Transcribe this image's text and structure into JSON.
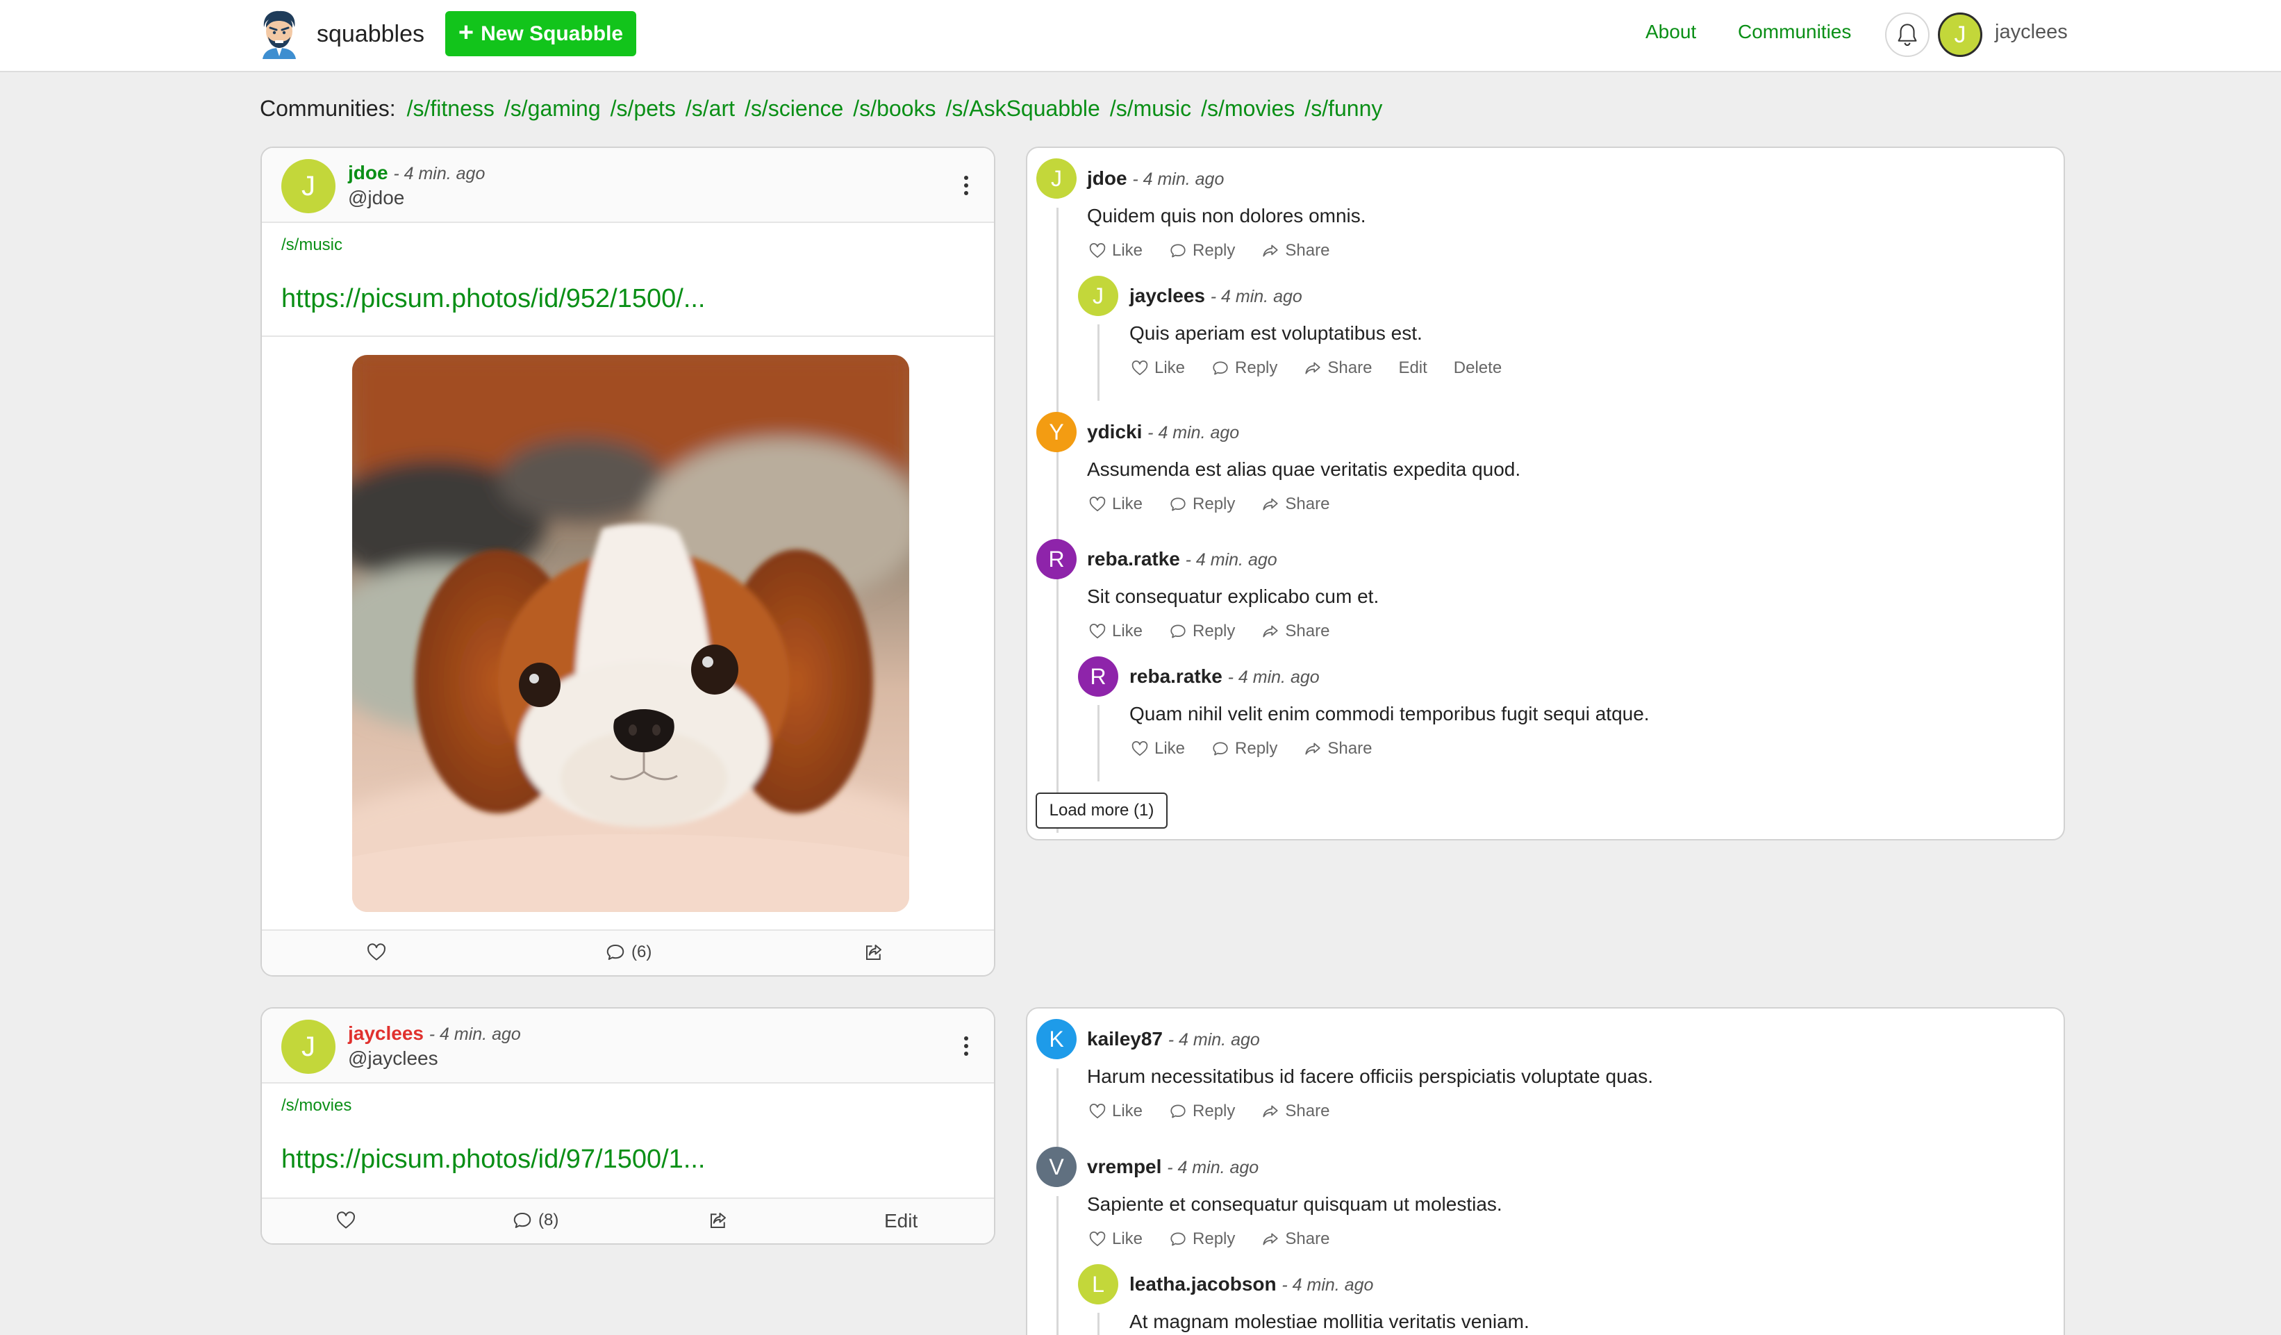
{
  "nav": {
    "brand": "squabbles",
    "new_button": "New Squabble",
    "about": "About",
    "communities": "Communities",
    "user_initial": "J",
    "username": "jayclees"
  },
  "communities_bar": {
    "label": "Communities:",
    "items": [
      "/s/fitness",
      "/s/gaming",
      "/s/pets",
      "/s/art",
      "/s/science",
      "/s/books",
      "/s/AskSquabble",
      "/s/music",
      "/s/movies",
      "/s/funny"
    ]
  },
  "posts": [
    {
      "initial": "J",
      "author": "jdoe",
      "time": "- 4 min. ago",
      "handle": "@jdoe",
      "community": "/s/music",
      "link": "https://picsum.photos/id/952/1500/...",
      "comment_count": "(6)"
    },
    {
      "initial": "J",
      "author": "jayclees",
      "time": "- 4 min. ago",
      "handle": "@jayclees",
      "community": "/s/movies",
      "link": "https://picsum.photos/id/97/1500/1...",
      "comment_count": "(8)",
      "edit": "Edit"
    }
  ],
  "actions": {
    "like": "Like",
    "reply": "Reply",
    "share": "Share",
    "edit": "Edit",
    "delete": "Delete"
  },
  "comments_1": [
    {
      "initial": "J",
      "author": "jdoe",
      "time": "- 4 min. ago",
      "text": "Quidem quis non dolores omnis.",
      "color": "#c3d73a"
    },
    {
      "initial": "J",
      "author": "jayclees",
      "time": "- 4 min. ago",
      "text": "Quis aperiam est voluptatibus est.",
      "color": "#c3d73a"
    },
    {
      "initial": "Y",
      "author": "ydicki",
      "time": "- 4 min. ago",
      "text": "Assumenda est alias quae veritatis expedita quod.",
      "color": "#f39c12"
    },
    {
      "initial": "R",
      "author": "reba.ratke",
      "time": "- 4 min. ago",
      "text": "Sit consequatur explicabo cum et.",
      "color": "#8e24aa"
    },
    {
      "initial": "R",
      "author": "reba.ratke",
      "time": "- 4 min. ago",
      "text": "Quam nihil velit enim commodi temporibus fugit sequi atque.",
      "color": "#8e24aa"
    }
  ],
  "load_more": "Load more (1)",
  "comments_2": [
    {
      "initial": "K",
      "author": "kailey87",
      "time": "- 4 min. ago",
      "text": "Harum necessitatibus id facere officiis perspiciatis voluptate quas.",
      "color": "#1e9be9"
    },
    {
      "initial": "V",
      "author": "vrempel",
      "time": "- 4 min. ago",
      "text": "Sapiente et consequatur quisquam ut molestias.",
      "color": "#607080"
    },
    {
      "initial": "L",
      "author": "leatha.jacobson",
      "time": "- 4 min. ago",
      "text": "At magnam molestiae mollitia veritatis veniam.",
      "color": "#c3d73a"
    }
  ],
  "colors": {
    "accent_green": "#0a8f16",
    "button_green": "#12c41b",
    "highlight_red": "#e0312e"
  }
}
